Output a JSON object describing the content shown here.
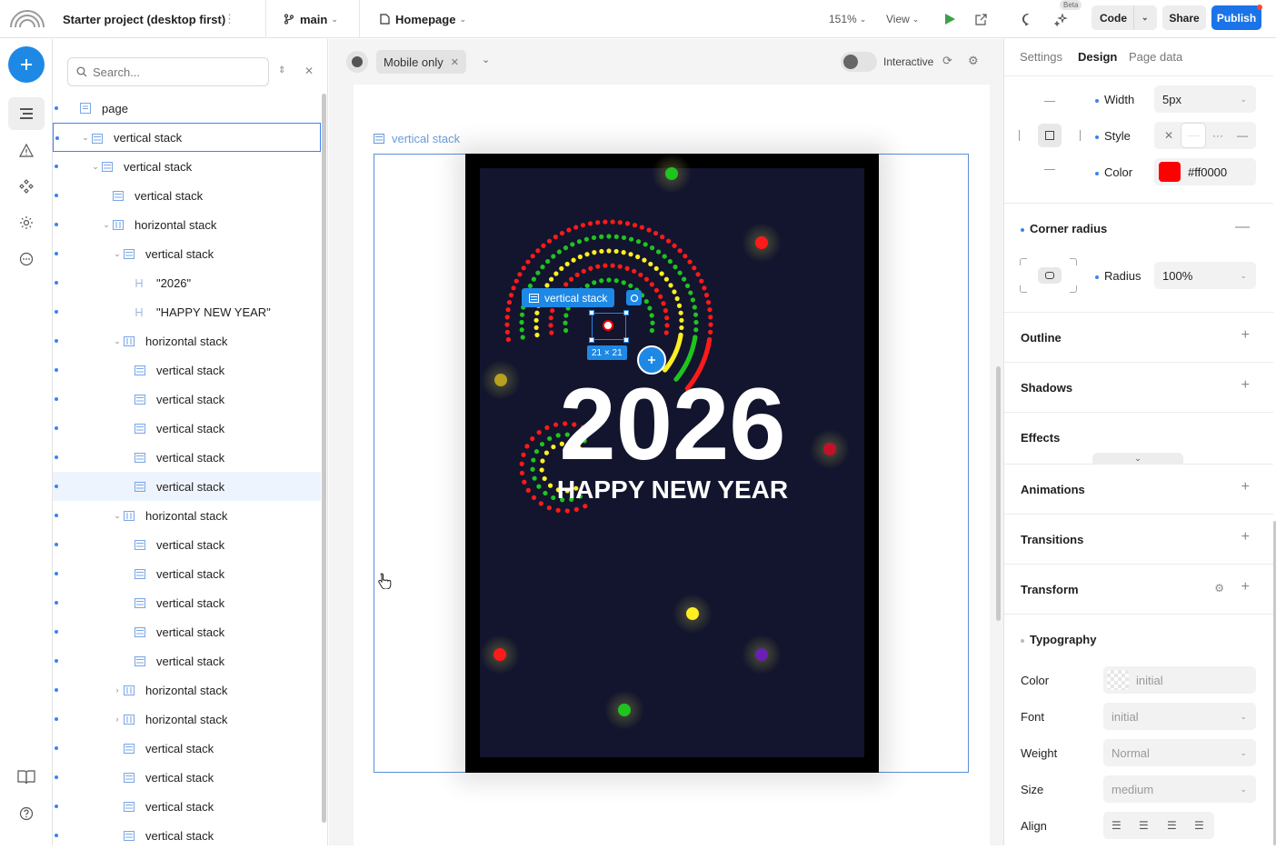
{
  "topbar": {
    "project_name": "Starter project (desktop first)",
    "branch": "main",
    "page": "Homepage",
    "zoom": "151%",
    "view": "View",
    "beta_badge": "Beta",
    "code_label": "Code",
    "share_label": "Share",
    "publish_label": "Publish"
  },
  "navigator": {
    "search_placeholder": "Search...",
    "items": [
      {
        "label": "page",
        "icon": "page"
      },
      {
        "label": "vertical stack",
        "icon": "vstack"
      },
      {
        "label": "vertical stack",
        "icon": "vstack"
      },
      {
        "label": "vertical stack",
        "icon": "vstack"
      },
      {
        "label": "horizontal stack",
        "icon": "hstack"
      },
      {
        "label": "vertical stack",
        "icon": "vstack"
      },
      {
        "label": "\"2026\"",
        "icon": "heading"
      },
      {
        "label": "\"HAPPY NEW YEAR\"",
        "icon": "heading"
      },
      {
        "label": "horizontal stack",
        "icon": "hstack"
      },
      {
        "label": "vertical stack",
        "icon": "vstack"
      },
      {
        "label": "vertical stack",
        "icon": "vstack"
      },
      {
        "label": "vertical stack",
        "icon": "vstack"
      },
      {
        "label": "vertical stack",
        "icon": "vstack"
      },
      {
        "label": "vertical stack",
        "icon": "vstack"
      },
      {
        "label": "horizontal stack",
        "icon": "hstack"
      },
      {
        "label": "vertical stack",
        "icon": "vstack"
      },
      {
        "label": "vertical stack",
        "icon": "vstack"
      },
      {
        "label": "vertical stack",
        "icon": "vstack"
      },
      {
        "label": "vertical stack",
        "icon": "vstack"
      },
      {
        "label": "vertical stack",
        "icon": "vstack"
      },
      {
        "label": "horizontal stack",
        "icon": "hstack"
      },
      {
        "label": "horizontal stack",
        "icon": "hstack"
      },
      {
        "label": "vertical stack",
        "icon": "vstack"
      },
      {
        "label": "vertical stack",
        "icon": "vstack"
      },
      {
        "label": "vertical stack",
        "icon": "vstack"
      },
      {
        "label": "vertical stack",
        "icon": "vstack"
      }
    ]
  },
  "canvas": {
    "breakpoint_chip": "Mobile only",
    "interactive_label": "Interactive",
    "frame_label": "vertical stack",
    "selection_label": "vertical stack",
    "selection_size": "21 × 21",
    "heading_year": "2026",
    "heading_greeting": "HAPPY NEW YEAR"
  },
  "panel": {
    "tabs": [
      "Settings",
      "Design",
      "Page data"
    ],
    "active_tab": "Design",
    "border": {
      "width_label": "Width",
      "width_value": "5px",
      "style_label": "Style",
      "color_label": "Color",
      "color_value": "#ff0000",
      "color_swatch": "#ff0000"
    },
    "corner_radius": {
      "title": "Corner radius",
      "radius_label": "Radius",
      "radius_value": "100%"
    },
    "sections": [
      "Outline",
      "Shadows",
      "Effects",
      "Animations",
      "Transitions",
      "Transform"
    ],
    "typography": {
      "title": "Typography",
      "color_label": "Color",
      "color_value": "initial",
      "font_label": "Font",
      "font_value": "initial",
      "weight_label": "Weight",
      "weight_value": "Normal",
      "size_label": "Size",
      "size_value": "medium",
      "align_label": "Align"
    }
  },
  "colors": {
    "accent": "#1e88e5",
    "publish": "#1a73e8",
    "poster_bg": "#12152d",
    "firework_red": "#ff1a1a",
    "firework_green": "#1fc41f",
    "firework_yellow": "#ffee22"
  }
}
